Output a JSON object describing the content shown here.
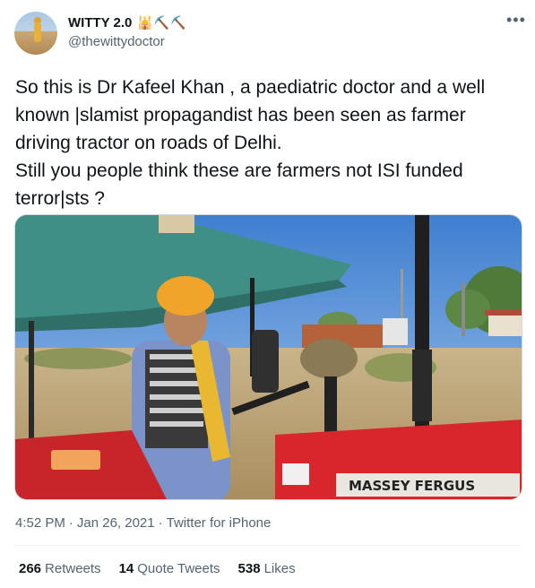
{
  "author": {
    "name": "WITTY 2.0",
    "badges": "🕌⛏️⛏️",
    "handle": "@thewittydoctor"
  },
  "tweet": {
    "line1": "So this is Dr Kafeel Khan , a paediatric doctor and a well known |slamist propagandist has been seen as farmer driving tractor on roads of Delhi.",
    "line2": "Still you people think these are farmers not ISI funded terror|sts ?"
  },
  "media": {
    "tractor_brand": "MASSEY FERGUS"
  },
  "meta": {
    "time": "4:52 PM",
    "sep1": "·",
    "date": "Jan 26, 2021",
    "sep2": "·",
    "source": "Twitter for iPhone"
  },
  "stats": [
    {
      "num": "266",
      "label": "Retweets"
    },
    {
      "num": "14",
      "label": "Quote Tweets"
    },
    {
      "num": "538",
      "label": "Likes"
    }
  ],
  "icons": {
    "more": "more-options-icon"
  },
  "colors": {
    "text": "#0f1419",
    "secondary": "#536471",
    "tractor_red": "#d8262c",
    "canopy_green": "#3f8f86"
  }
}
